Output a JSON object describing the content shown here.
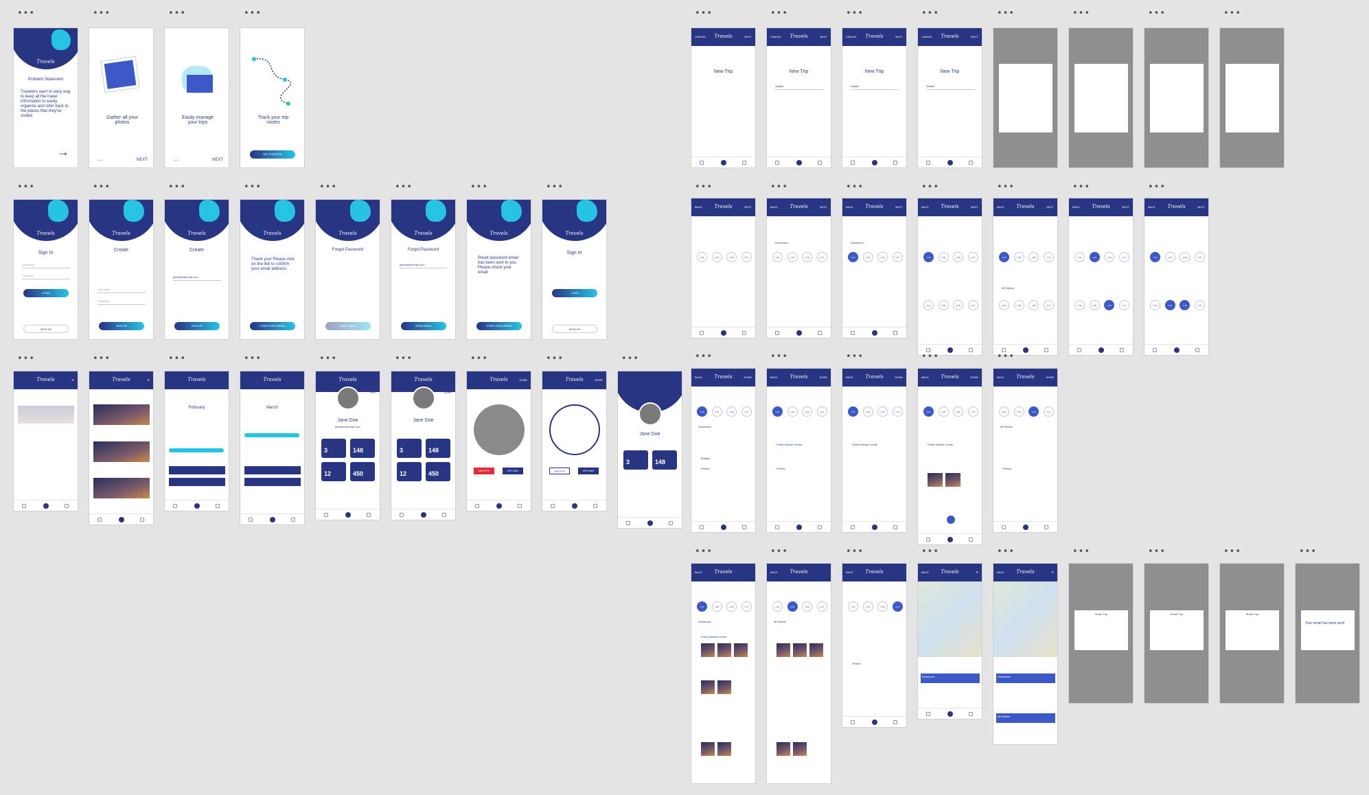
{
  "onboarding": {
    "problem_title": "Problem Statement",
    "problem_text": "Travelers want or easy way to keep all the travel information to easily organize and refer back to the places that they've visited",
    "gather": "Gather all your photos",
    "manage": "Easily manage your trips",
    "track": "Track your trip routes",
    "skip": "SKIP",
    "next": "NEXT",
    "get_started": "GET STARTED"
  },
  "brand": "Travels",
  "auth": {
    "sign_in": "Sign In",
    "create": "Create",
    "forgot": "Forgot Password",
    "thanks": "Thank you! Please click on the link to confirm your email address.",
    "reset": "Reset password email has been sent to you. Please check your email",
    "login": "LOGIN",
    "sign_up": "SIGN UP",
    "send_email": "SEND EMAIL",
    "start_exploring": "START EXPLORING",
    "username": "Username",
    "password": "Password",
    "email_value": "janedoe@email.com"
  },
  "home": {
    "february": "February",
    "march": "March"
  },
  "profile": {
    "name": "Jane Doe",
    "email": "janedoe@email.com",
    "edit": "EDIT",
    "done": "DONE",
    "trips": "3",
    "trips_label": "Trips",
    "photos": "148",
    "photos_label": "Photos",
    "locations": "12",
    "locations_label": "Locations",
    "budget": "450",
    "budget_label": "Avg Budget",
    "delete": "DELETE",
    "upload": "UPLOAD"
  },
  "trip": {
    "cancel": "CANCEL",
    "back": "BACK",
    "next": "NEXT",
    "done": "DONE",
    "new_trip": "New Trip",
    "seattle": "Seattle",
    "downtown": "Downtown",
    "mt_rainier": "Mt Rainier",
    "public_market": "Public Market Center",
    "photos": "Photos",
    "budget": "Budget",
    "days": [
      "2.24",
      "2.25",
      "2.26",
      "2.27"
    ]
  },
  "dialogs": {
    "share_trip": "Share Trip",
    "email_sent": "Your email has been sent!"
  },
  "colors": {
    "primary": "#283583",
    "accent": "#27c3e4"
  }
}
